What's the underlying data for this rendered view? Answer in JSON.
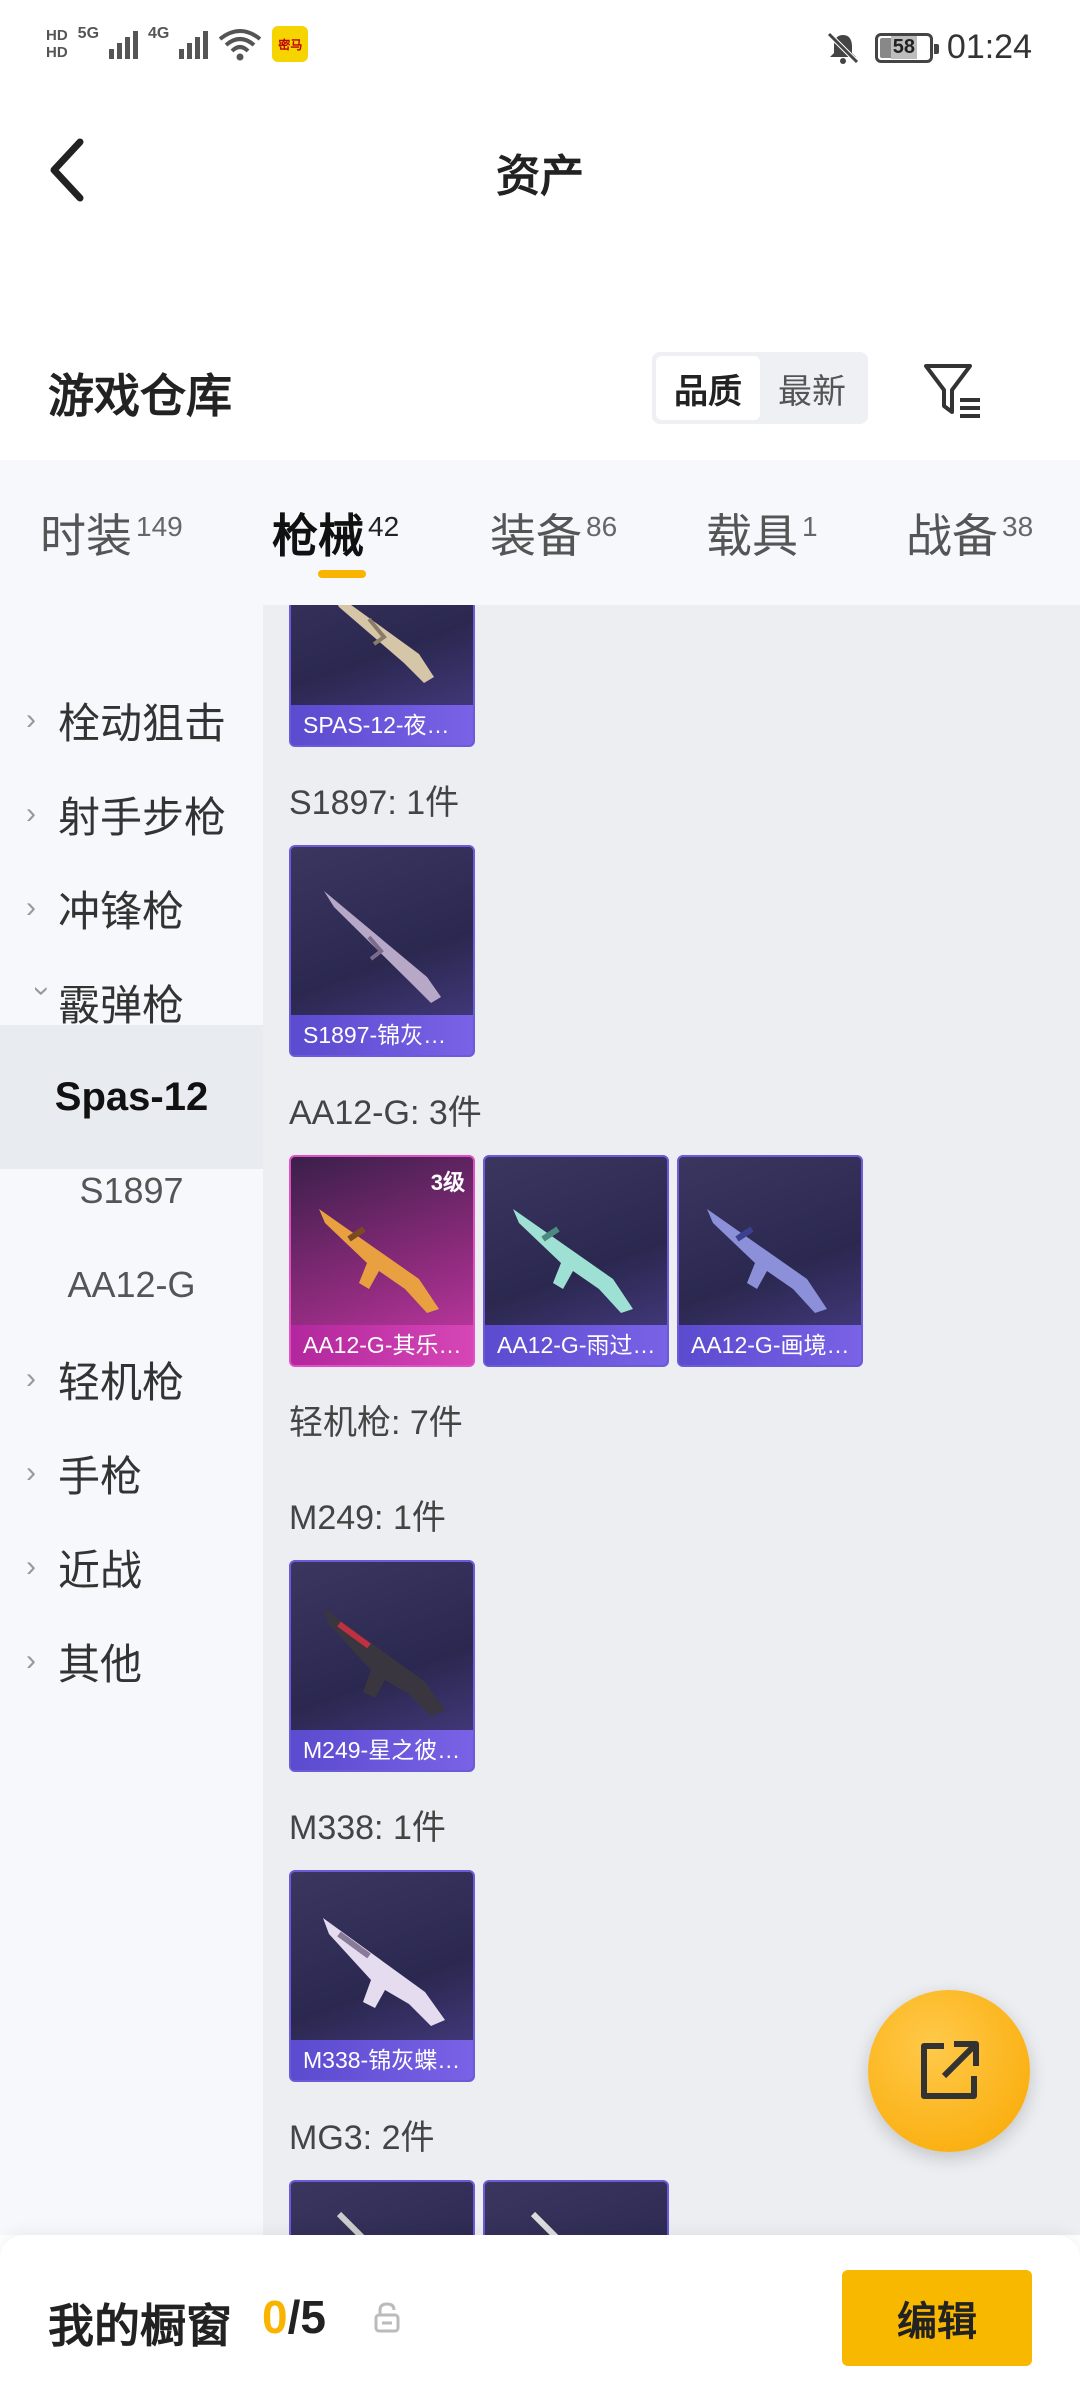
{
  "status_bar": {
    "hd_top": "HD",
    "hd_bottom": "HD",
    "net_5g": "5G",
    "net_4g": "4G",
    "app_badge": "密马",
    "battery": "58",
    "time": "01:24"
  },
  "header": {
    "title": "资产",
    "back_icon": "chevron-left-icon"
  },
  "warehouse": {
    "title": "游戏仓库",
    "sort_options": [
      "品质",
      "最新"
    ],
    "sort_selected": "品质",
    "filter_icon": "filter-icon"
  },
  "tabs": [
    {
      "label": "时装",
      "count": "149"
    },
    {
      "label": "枪械",
      "count": "42"
    },
    {
      "label": "装备",
      "count": "86"
    },
    {
      "label": "载具",
      "count": "1"
    },
    {
      "label": "战备",
      "count": "38"
    }
  ],
  "active_tab": "枪械",
  "sidebar": {
    "items": [
      {
        "label": "栓动狙击"
      },
      {
        "label": "射手步枪"
      },
      {
        "label": "冲锋枪"
      },
      {
        "label": "霰弹枪"
      },
      {
        "label": "Spas-12"
      },
      {
        "label": "S1897"
      },
      {
        "label": "AA12-G"
      },
      {
        "label": "轻机枪"
      },
      {
        "label": "手枪"
      },
      {
        "label": "近战"
      },
      {
        "label": "其他"
      }
    ]
  },
  "content": {
    "top_card": {
      "label": "SPAS-12-夜…"
    },
    "groups": [
      {
        "label": "S1897: 1件",
        "cards": [
          {
            "label": "S1897-锦灰…"
          }
        ]
      },
      {
        "label": "AA12-G: 3件",
        "cards": [
          {
            "label": "AA12-G-其乐…",
            "level": "3级"
          },
          {
            "label": "AA12-G-雨过…"
          },
          {
            "label": "AA12-G-画境…"
          }
        ]
      },
      {
        "label": "轻机枪: 7件"
      },
      {
        "label": "M249: 1件",
        "cards": [
          {
            "label": "M249-星之彼…"
          }
        ]
      },
      {
        "label": "M338: 1件",
        "cards": [
          {
            "label": "M338-锦灰蝶…"
          }
        ]
      },
      {
        "label": "MG3: 2件"
      }
    ]
  },
  "fab_icon": "share-export-icon",
  "bottom_bar": {
    "title": "我的橱窗",
    "count_current": "0",
    "count_total": "/5",
    "lock_icon": "lock-icon",
    "edit_label": "编辑"
  },
  "colors": {
    "accent": "#f9b400",
    "card_purple": "#6c5bd8",
    "card_pink": "#d646b6"
  }
}
